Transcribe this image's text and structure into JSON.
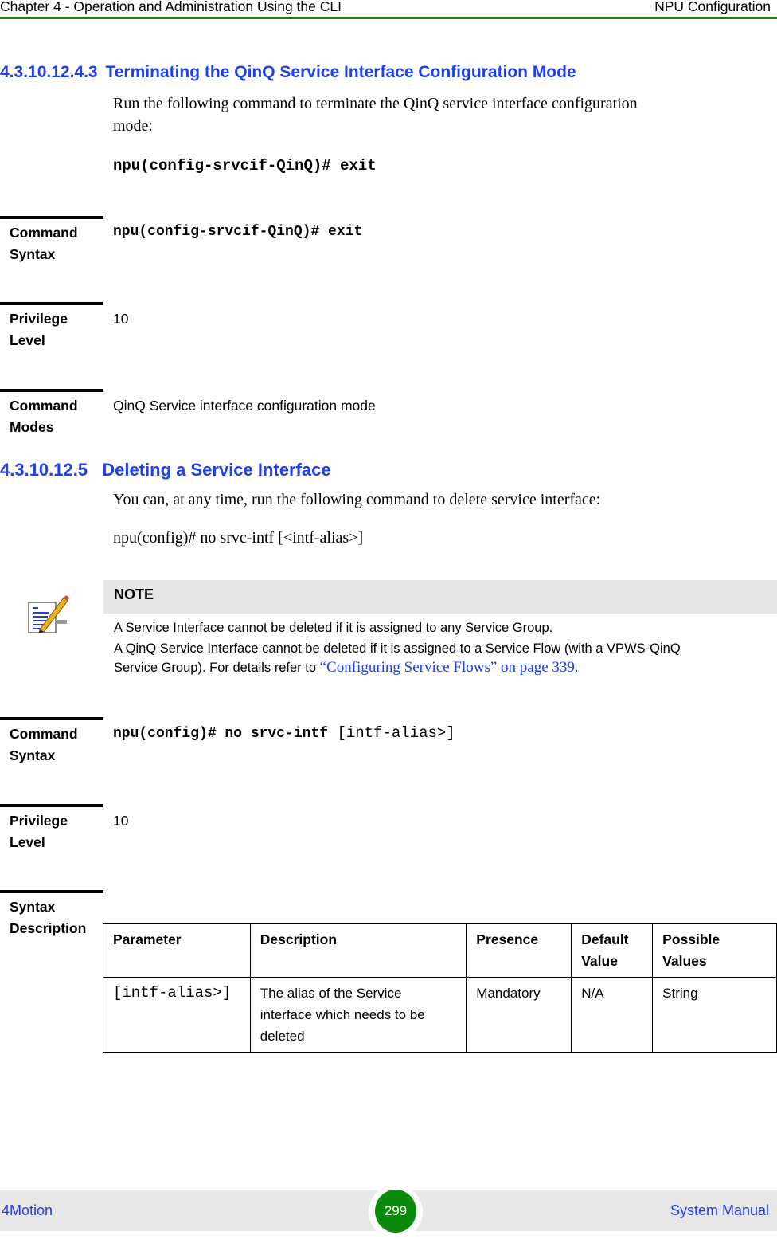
{
  "header": {
    "chapter": "Chapter 4 - Operation and Administration Using the CLI",
    "section": "NPU Configuration",
    "accent_color": "#0a8a0a"
  },
  "section1": {
    "number": "4.3.10.12.4.3",
    "title": "Terminating the QinQ Service Interface Configuration Mode",
    "intro_line1": "Run the following command to terminate the QinQ service interface configuration",
    "intro_line2": "mode:",
    "command": "npu(config-srvcif-QinQ)# exit",
    "command_syntax_label_1": "Command",
    "command_syntax_label_2": "Syntax",
    "command_syntax": "npu(config-srvcif-QinQ)# exit",
    "privilege_label_1": "Privilege",
    "privilege_label_2": "Level",
    "privilege_level": "10",
    "modes_label_1": "Command",
    "modes_label_2": "Modes",
    "command_modes": "QinQ Service interface configuration mode"
  },
  "section2": {
    "number": "4.3.10.12.5",
    "title": "Deleting a Service Interface",
    "intro": "You can, at any time, run the following command to delete service interface:",
    "command": "npu(config)# no srvc-intf [<intf-alias>]",
    "note": {
      "title": "NOTE",
      "icon": "note-pencil-icon",
      "line1": "A Service Interface cannot be deleted if it is assigned to any Service Group.",
      "line2": "A QinQ Service Interface cannot be deleted if it is assigned to a Service Flow (with a VPWS-QinQ",
      "line3_prefix": "Service Group). For details refer to ",
      "line3_link": "“Configuring Service Flows” on page 339",
      "line3_suffix": "."
    },
    "command_syntax_label_1": "Command",
    "command_syntax_label_2": "Syntax",
    "command_syntax_bold": "npu(config)# no srvc-intf",
    "command_syntax_arg": " [intf-alias>]",
    "privilege_label_1": "Privilege",
    "privilege_label_2": "Level",
    "privilege_level": "10",
    "syntax_desc_label_1": "Syntax",
    "syntax_desc_label_2": "Description",
    "table": {
      "headers": [
        "Parameter",
        "Description",
        "Presence",
        "Default Value",
        "Possible Values"
      ],
      "rows": [
        [
          "[intf-alias>]",
          "The alias of the Service interface which needs to be deleted",
          "Mandatory",
          "N/A",
          "String"
        ]
      ]
    }
  },
  "footer": {
    "left": "4Motion",
    "page_number": "299",
    "right": "System Manual"
  }
}
